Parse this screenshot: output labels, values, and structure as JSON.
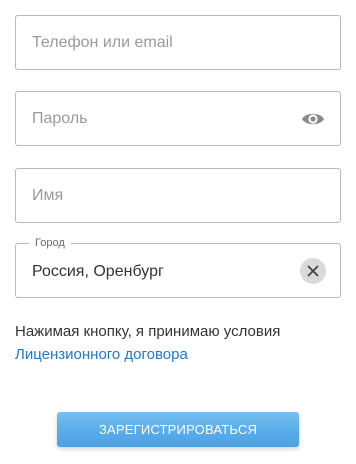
{
  "form": {
    "phone": {
      "placeholder": "Телефон или email",
      "value": ""
    },
    "password": {
      "placeholder": "Пароль",
      "value": "",
      "toggle_icon": "eye-icon"
    },
    "name": {
      "placeholder": "Имя",
      "value": ""
    },
    "city": {
      "label": "Город",
      "value": "Россия, Оренбург",
      "clear_icon": "close-icon"
    }
  },
  "terms": {
    "text": "Нажимая кнопку, я принимаю условия",
    "link_text": "Лицензионного договора"
  },
  "submit": {
    "label": "ЗАРЕГИСТРИРОВАТЬСЯ"
  },
  "colors": {
    "border": "#b9b9b9",
    "link": "#1f7ac9",
    "button": "#58acea",
    "icon": "#8a8a8a",
    "clear_bg": "#dadada"
  }
}
